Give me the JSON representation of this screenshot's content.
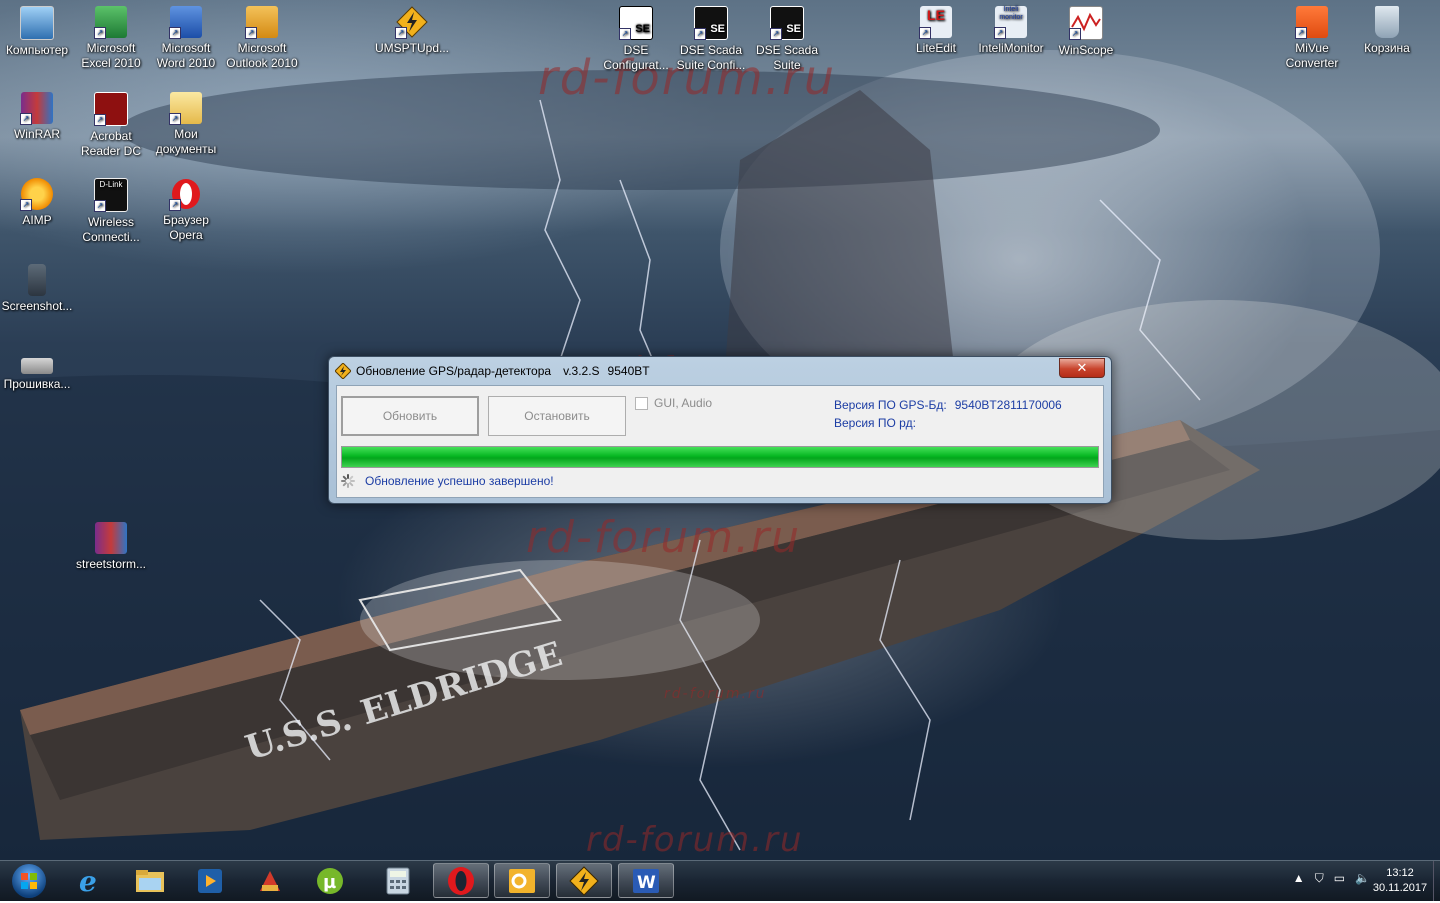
{
  "desktop": {
    "watermark": "rd-forum.ru",
    "ship_text": "U.S.S. ELDRIDGE",
    "icons": [
      {
        "label": "Компьютер",
        "icon": "computer-icon"
      },
      {
        "label": "Microsoft Excel 2010",
        "icon": "excel-icon"
      },
      {
        "label": "Microsoft Word 2010",
        "icon": "word-icon"
      },
      {
        "label": "Microsoft Outlook 2010",
        "icon": "outlook-icon"
      },
      {
        "label": "UMSPTUpd...",
        "icon": "umsptupd-icon"
      },
      {
        "label": "DSE Configurat...",
        "icon": "dse-config-icon"
      },
      {
        "label": "DSE Scada Suite Confi...",
        "icon": "dse-scada-config-icon"
      },
      {
        "label": "DSE Scada Suite",
        "icon": "dse-scada-icon"
      },
      {
        "label": "LiteEdit",
        "icon": "liteedit-icon"
      },
      {
        "label": "InteliMonitor",
        "icon": "intelimonitor-icon"
      },
      {
        "label": "WinScope",
        "icon": "winscope-icon"
      },
      {
        "label": "MiVue Converter",
        "icon": "mivue-icon"
      },
      {
        "label": "Корзина",
        "icon": "recycle-bin-icon"
      },
      {
        "label": "WinRAR",
        "icon": "winrar-icon"
      },
      {
        "label": "Acrobat Reader DC",
        "icon": "acrobat-icon"
      },
      {
        "label": "Мои документы",
        "icon": "my-documents-icon"
      },
      {
        "label": "AIMP",
        "icon": "aimp-icon"
      },
      {
        "label": "Wireless Connecti...",
        "icon": "dlink-wireless-icon"
      },
      {
        "label": "Браузер Opera",
        "icon": "opera-icon"
      },
      {
        "label": "Screenshot...",
        "icon": "screenshot-file-icon"
      },
      {
        "label": "Прошивка...",
        "icon": "firmware-file-icon"
      },
      {
        "label": "streetstorm...",
        "icon": "rar-archive-icon"
      }
    ]
  },
  "dialog": {
    "title": "Обновление GPS/радар-детектора",
    "version": "v.3.2.S",
    "model": "9540BT",
    "close_label": "✕",
    "update_button": "Обновить",
    "stop_button": "Остановить",
    "checkbox_label": "GUI, Audio",
    "gps_db_label": "Версия ПО GPS-Бд:",
    "gps_db_value": "9540BT2811170006",
    "rd_label": "Версия ПО рд:",
    "rd_value": "",
    "progress_percent": 100,
    "status": "Обновление успешно завершено!"
  },
  "taskbar": {
    "items": [
      {
        "icon": "internet-explorer-icon"
      },
      {
        "icon": "file-explorer-icon"
      },
      {
        "icon": "media-player-icon"
      },
      {
        "icon": "ccleaner-icon"
      },
      {
        "icon": "utorrent-icon"
      },
      {
        "icon": "calculator-icon"
      },
      {
        "icon": "opera-icon"
      },
      {
        "icon": "outlook-icon"
      },
      {
        "icon": "umsptupd-icon"
      },
      {
        "icon": "word-icon"
      }
    ],
    "tray_icons": [
      "show-hidden-icons-icon",
      "action-center-icon",
      "network-icon",
      "volume-icon"
    ],
    "time": "13:12",
    "date": "30.11.2017"
  }
}
